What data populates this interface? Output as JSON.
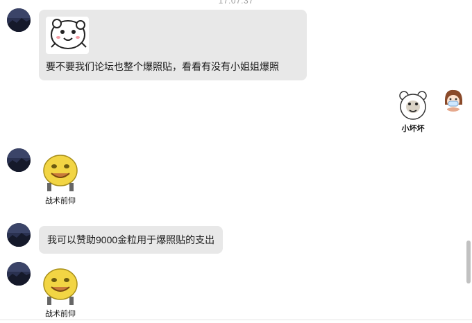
{
  "chat": {
    "timestamp": "17:07:37",
    "messages": [
      {
        "sender": "other",
        "type": "image+text",
        "sticker": "cartoon-face-sticker",
        "text": "要不要我们论坛也整个爆照贴，看看有没有小姐姐爆照"
      },
      {
        "sender": "self",
        "type": "sticker",
        "sticker": "bear-meme-sticker",
        "caption": "小坏坏"
      },
      {
        "sender": "other",
        "type": "sticker",
        "sticker": "yellow-smiley-sticker",
        "caption": "战术前仰"
      },
      {
        "sender": "other",
        "type": "text",
        "text": "我可以赞助9000金粒用于爆照贴的支出"
      },
      {
        "sender": "other",
        "type": "sticker",
        "sticker": "yellow-smiley-sticker",
        "caption": "战术前仰"
      }
    ]
  },
  "colors": {
    "bubble_bg": "#e8e8e8",
    "timestamp": "#9a9a9a",
    "scrollbar": "#c1c1c1"
  }
}
